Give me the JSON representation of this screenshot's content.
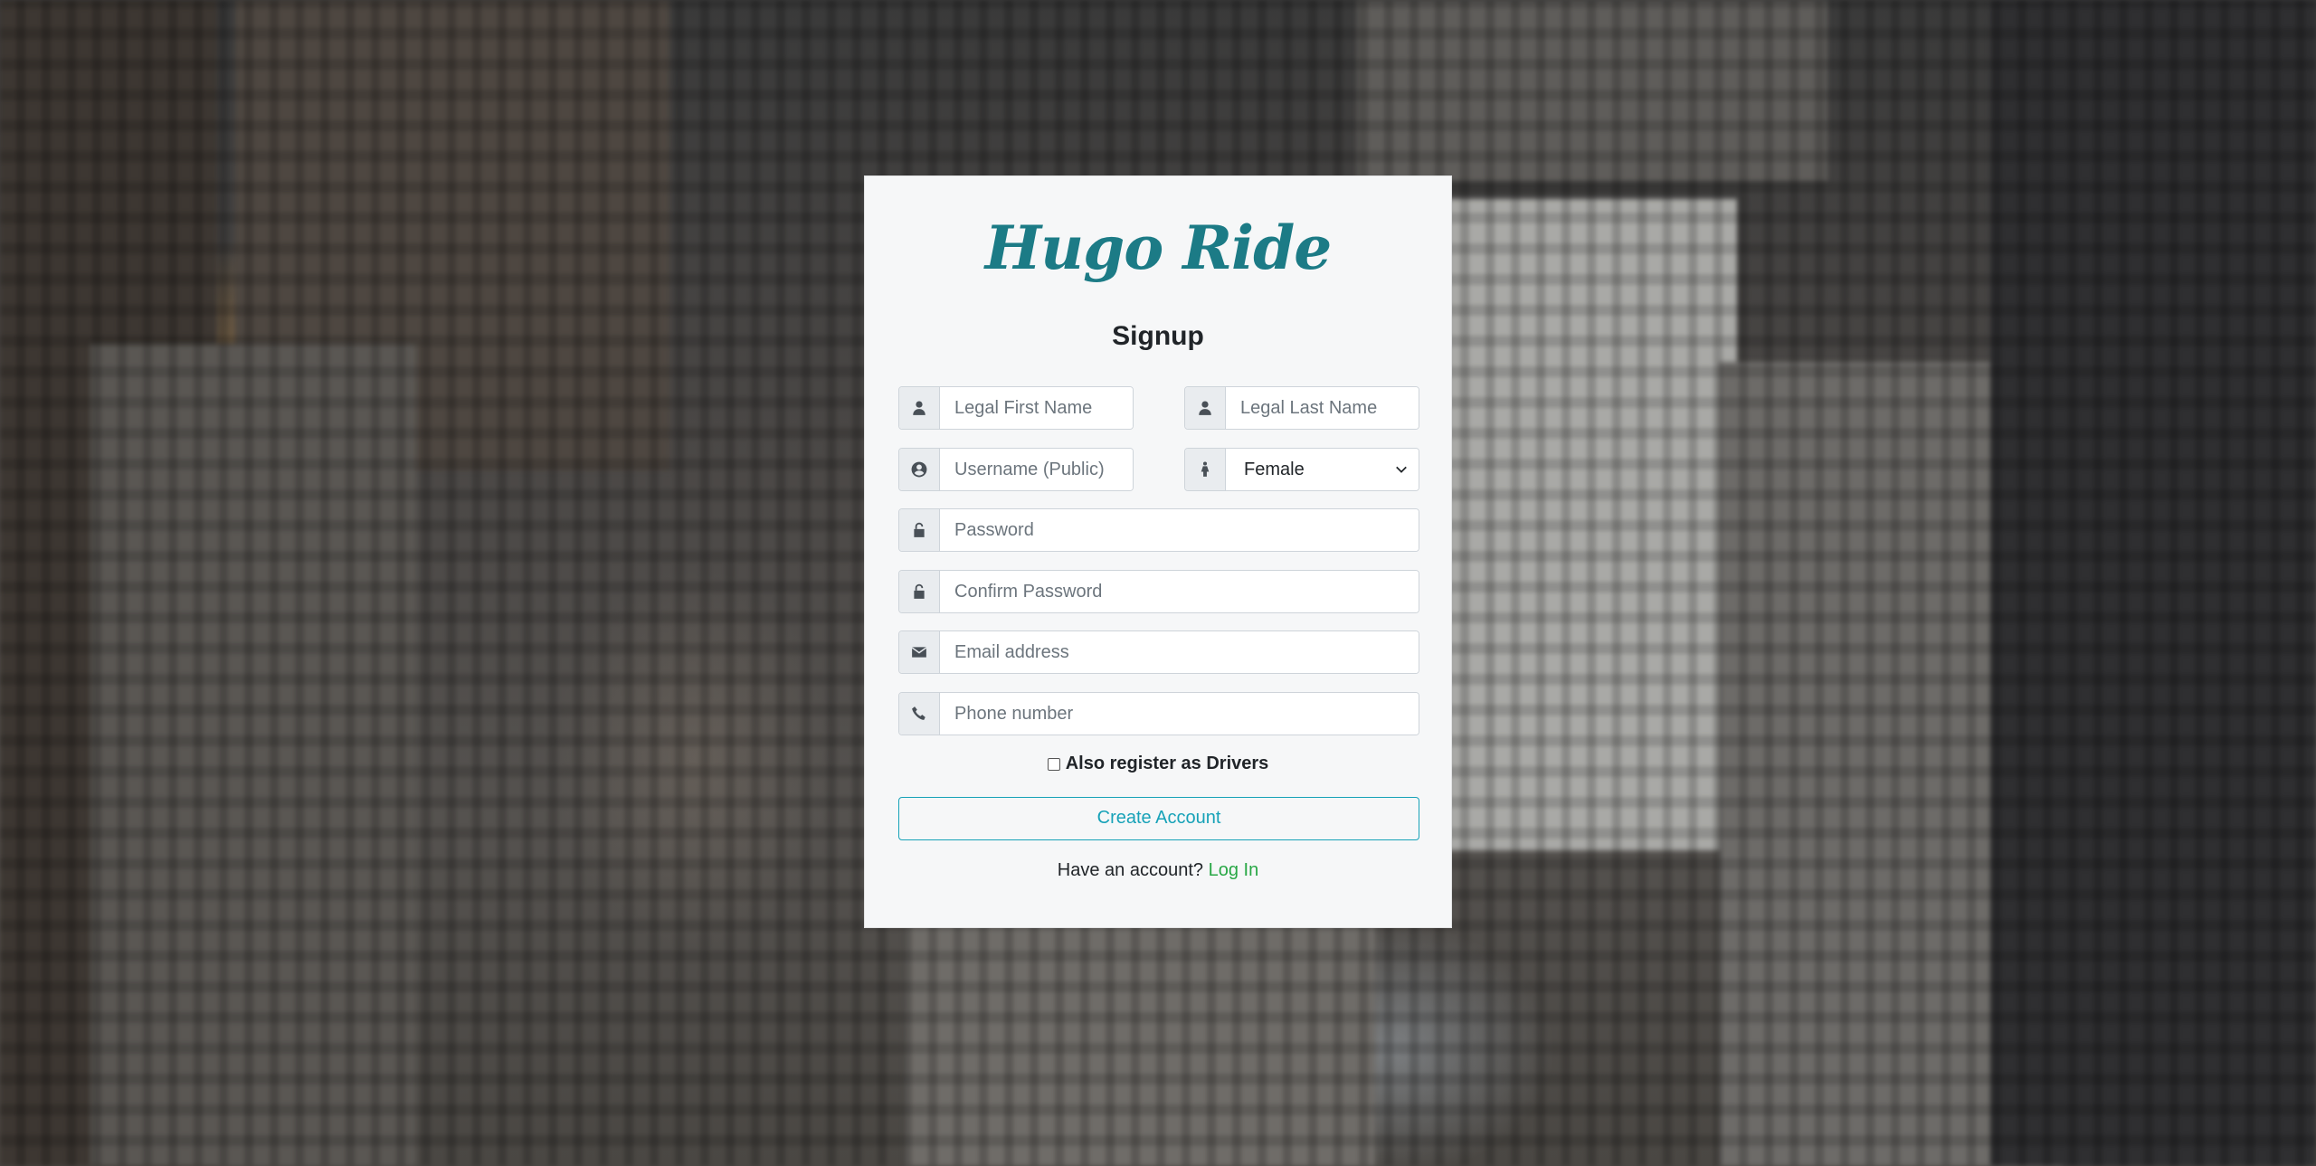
{
  "brand": {
    "logo_text": "Hugo Ride",
    "logo_color": "#1c7b86"
  },
  "form": {
    "heading": "Signup",
    "first_name": {
      "placeholder": "Legal First Name",
      "icon": "user-icon"
    },
    "last_name": {
      "placeholder": "Legal Last Name",
      "icon": "user-icon"
    },
    "username": {
      "placeholder": "Username (Public)",
      "icon": "user-circle-icon"
    },
    "gender": {
      "value": "Female",
      "icon": "female-icon"
    },
    "password": {
      "placeholder": "Password",
      "icon": "unlock-icon"
    },
    "confirm_password": {
      "placeholder": "Confirm Password",
      "icon": "unlock-icon"
    },
    "email": {
      "placeholder": "Email address",
      "icon": "envelope-icon"
    },
    "phone": {
      "placeholder": "Phone number",
      "icon": "phone-icon"
    },
    "driver_checkbox": {
      "label": "Also register as Drivers",
      "checked": false
    },
    "submit_label": "Create Account",
    "submit_color": "#17a2b8"
  },
  "footer": {
    "prompt": "Have an account?",
    "login_label": "Log In",
    "login_color": "#28a745"
  }
}
